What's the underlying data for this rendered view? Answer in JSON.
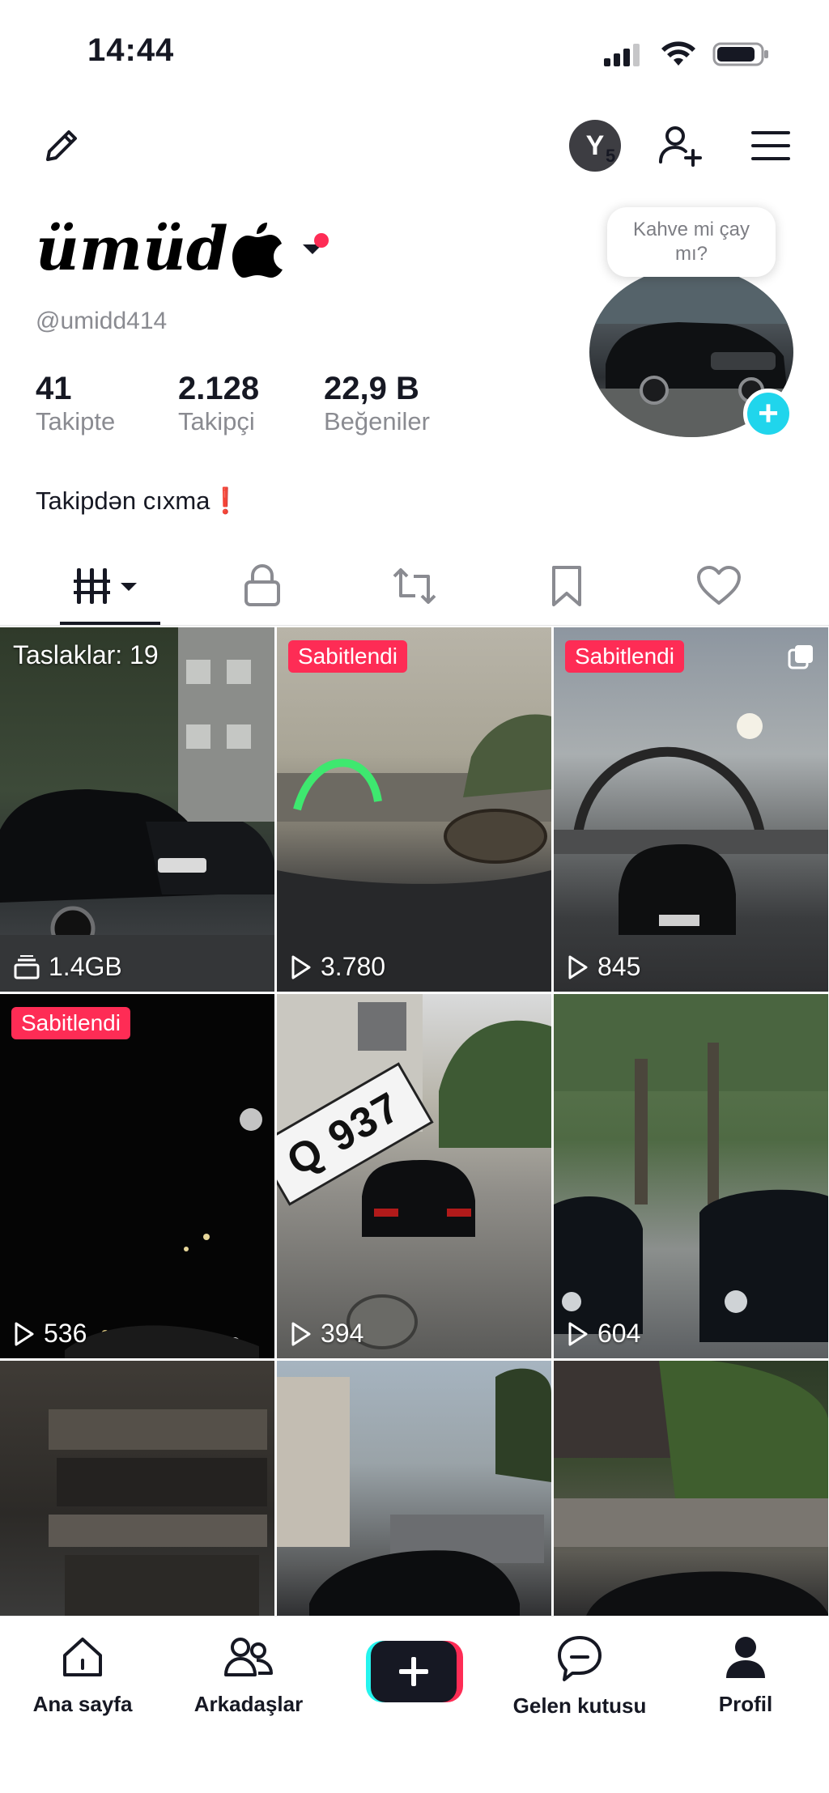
{
  "status_bar": {
    "time": "14:44"
  },
  "header": {
    "avatar_letter": "Y",
    "avatar_count": "5"
  },
  "profile": {
    "name": "ümüd",
    "username": "@umidd414",
    "bio": "Takipdən cıxma❗",
    "bubble_text_line1": "Kahve mi çay",
    "bubble_text_line2": "mı?",
    "stats": [
      {
        "value": "41",
        "label": "Takipte"
      },
      {
        "value": "2.128",
        "label": "Takipçi"
      },
      {
        "value": "22,9 B",
        "label": "Beğeniler"
      }
    ]
  },
  "tabs": [
    "videos",
    "private",
    "reposts",
    "favorites",
    "liked"
  ],
  "grid": [
    {
      "label": "Taslaklar: 19",
      "stat": "1.4GB",
      "stat_type": "storage"
    },
    {
      "badge": "Sabitlendi",
      "stat": "3.780",
      "stat_type": "play"
    },
    {
      "badge": "Sabitlendi",
      "stat": "845",
      "stat_type": "play",
      "multi": true
    },
    {
      "badge": "Sabitlendi",
      "stat": "536",
      "stat_type": "play"
    },
    {
      "stat": "394",
      "stat_type": "play",
      "plate_text": "Q 937"
    },
    {
      "stat": "604",
      "stat_type": "play"
    },
    {},
    {},
    {}
  ],
  "bottom_nav": [
    {
      "label": "Ana sayfa",
      "icon": "home-icon"
    },
    {
      "label": "Arkadaşlar",
      "icon": "friends-icon"
    },
    {
      "label": "",
      "icon": "create-icon"
    },
    {
      "label": "Gelen kutusu",
      "icon": "inbox-icon"
    },
    {
      "label": "Profil",
      "icon": "profile-icon"
    }
  ],
  "colors": {
    "accent": "#fe2c55",
    "cyan": "#20d5ec",
    "text": "#161823",
    "muted": "#8a8b91"
  }
}
